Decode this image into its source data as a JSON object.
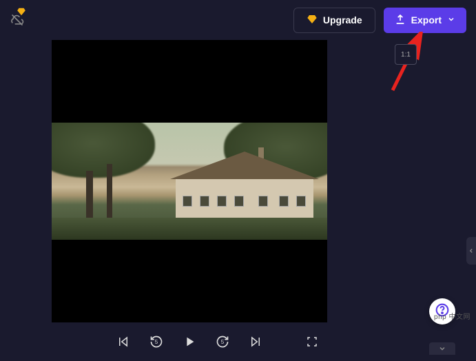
{
  "header": {
    "upgrade_label": "Upgrade",
    "export_label": "Export"
  },
  "aspect": {
    "label": "1:1"
  },
  "watermark": "php 中文网",
  "icons": {
    "cloud_off": "cloud-off-icon",
    "premium": "diamond-icon",
    "upload": "upload-icon",
    "chevron_down": "chevron-down-icon",
    "prev": "skip-prev-icon",
    "rewind5": "rewind-5-icon",
    "play": "play-icon",
    "forward5": "forward-5-icon",
    "next": "skip-next-icon",
    "fullscreen": "fullscreen-icon",
    "help": "help-icon"
  }
}
